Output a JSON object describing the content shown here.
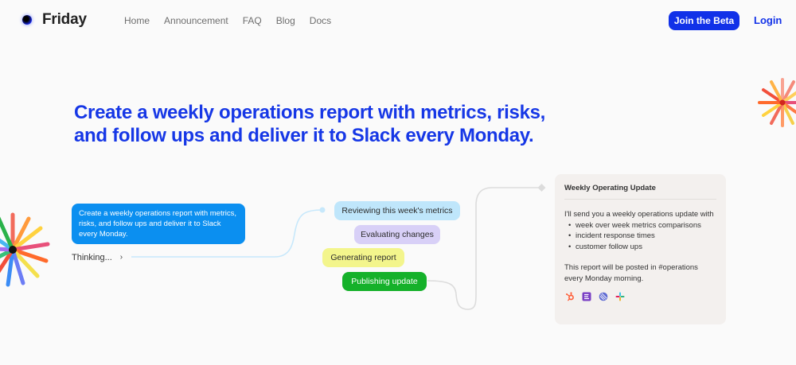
{
  "brand": {
    "name": "Friday"
  },
  "nav": {
    "items": [
      {
        "label": "Home"
      },
      {
        "label": "Announcement"
      },
      {
        "label": "FAQ"
      },
      {
        "label": "Blog"
      },
      {
        "label": "Docs"
      }
    ]
  },
  "header": {
    "cta_label": "Join the Beta",
    "login_label": "Login"
  },
  "hero": {
    "line1": "Create a weekly operations report with metrics, risks,",
    "line2": "and follow ups and deliver it to Slack every Monday."
  },
  "prompt": {
    "text": "Create a weekly operations report with metrics, risks, and follow ups and deliver it to Slack every Monday.",
    "thinking": "Thinking...",
    "chevron": "›"
  },
  "steps": [
    {
      "label": "Reviewing this week's metrics",
      "color": "#bfe6fb"
    },
    {
      "label": "Evaluating changes",
      "color": "#d8d0f7"
    },
    {
      "label": "Generating report",
      "color": "#f3f58c"
    },
    {
      "label": "Publishing update",
      "color": "#15b12a"
    }
  ],
  "card": {
    "title": "Weekly Operating Update",
    "intro": "I'll send you a weekly operations update with",
    "items": [
      "week over week metrics comparisons",
      "incident response times",
      "customer follow ups"
    ],
    "footer": "This report will be posted in #operations every Monday morning.",
    "icons": [
      "hubspot-icon",
      "stripe-icon",
      "linear-icon",
      "slack-icon"
    ]
  },
  "colors": {
    "accent": "#1131e8",
    "headline": "#1637e6",
    "prompt_bubble": "#0b8ff0",
    "card_bg": "#f3f0ee"
  }
}
